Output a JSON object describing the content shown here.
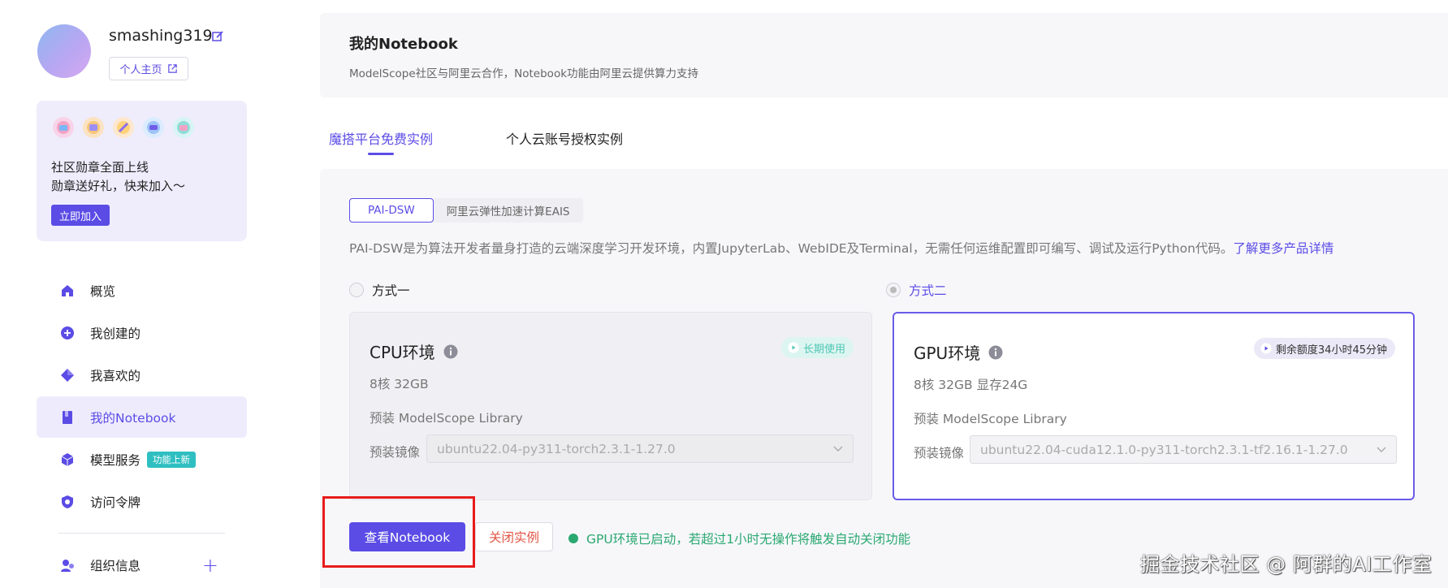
{
  "profile": {
    "username": "smashing319",
    "home_label": "个人主页"
  },
  "promo": {
    "line1": "社区勋章全面上线",
    "line2": "勋章送好礼，快来加入～",
    "join_label": "立即加入"
  },
  "nav": {
    "items": [
      {
        "label": "概览",
        "icon": "home-icon"
      },
      {
        "label": "我创建的",
        "icon": "plus-circle-icon"
      },
      {
        "label": "我喜欢的",
        "icon": "diamond-icon"
      },
      {
        "label": "我的Notebook",
        "icon": "notebook-icon",
        "active": true
      },
      {
        "label": "模型服务",
        "icon": "cube-icon",
        "tag": "功能上新"
      },
      {
        "label": "访问令牌",
        "icon": "shield-icon"
      }
    ],
    "org_label": "组织信息"
  },
  "header": {
    "title": "我的Notebook",
    "subtitle": "ModelScope社区与阿里云合作，Notebook功能由阿里云提供算力支持"
  },
  "tabs": [
    {
      "label": "魔搭平台免费实例",
      "active": true
    },
    {
      "label": "个人云账号授权实例",
      "active": false
    }
  ],
  "segment": {
    "on_label": "PAI-DSW",
    "off_label": "阿里云弹性加速计算EAIS"
  },
  "description": {
    "text": "PAI-DSW是为算法开发者量身打造的云端深度学习开发环境，内置JupyterLab、WebIDE及Terminal，无需任何运维配置即可编写、调试及运行Python代码。",
    "link": "了解更多产品详情"
  },
  "options": {
    "option1": "方式一",
    "option2": "方式二",
    "selected": "option2"
  },
  "cpu_card": {
    "title": "CPU环境",
    "chip": "长期使用",
    "spec": "8核 32GB",
    "lib": "预装 ModelScope Library",
    "image_label": "预装镜像",
    "image_value": "ubuntu22.04-py311-torch2.3.1-1.27.0"
  },
  "gpu_card": {
    "title": "GPU环境",
    "chip": "剩余额度34小时45分钟",
    "spec": "8核 32GB 显存24G",
    "lib": "预装 ModelScope Library",
    "image_label": "预装镜像",
    "image_value": "ubuntu22.04-cuda12.1.0-py311-torch2.3.1-tf2.16.1-1.27.0"
  },
  "actions": {
    "view_label": "查看Notebook",
    "close_label": "关闭实例",
    "status": "GPU环境已启动，若超过1小时无操作将触发自动关闭功能"
  },
  "watermark": "掘金技术社区 @ 阿群的AI工作室",
  "colors": {
    "accent": "#5b4ce6",
    "status_green": "#2aa870",
    "danger": "#e25545",
    "highlight_red": "#e81b1b"
  }
}
